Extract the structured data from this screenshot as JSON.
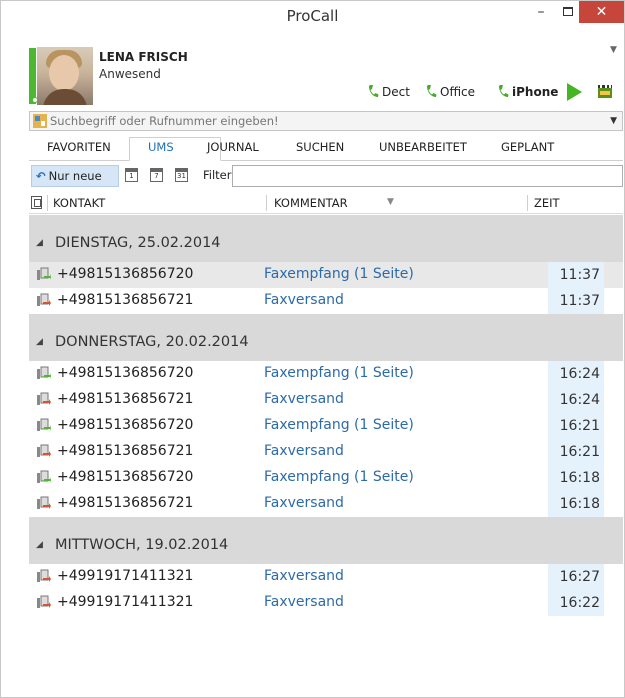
{
  "window": {
    "title": "ProCall",
    "minimize_glyph": "–",
    "close_glyph": "✕"
  },
  "user": {
    "name": "LENA FRISCH",
    "status": "Anwesend",
    "status_color": "#4cb82f"
  },
  "devices": [
    {
      "label": "Dect",
      "icon": "phone-icon"
    },
    {
      "label": "Office",
      "icon": "phone-icon"
    },
    {
      "label": "iPhone",
      "icon": "phone-icon"
    }
  ],
  "search": {
    "placeholder": "Suchbegriff oder Rufnummer eingeben!"
  },
  "tabs": [
    {
      "label": "FAVORITEN",
      "active": false
    },
    {
      "label": "UMS",
      "active": true
    },
    {
      "label": "JOURNAL",
      "active": false
    },
    {
      "label": "SUCHEN",
      "active": false
    },
    {
      "label": "UNBEARBEITET",
      "active": false
    },
    {
      "label": "GEPLANT",
      "active": false
    }
  ],
  "toolbar": {
    "nur_neue_label": "Nur neue",
    "cal_day": "1",
    "cal_week": "7",
    "cal_month": "31",
    "filter_label": "Filter",
    "filter_value": ""
  },
  "columns": {
    "kontakt": "KONTAKT",
    "kommentar": "KOMMENTAR",
    "zeit": "ZEIT"
  },
  "groups": [
    {
      "title": "DIENSTAG, 25.02.2014",
      "rows": [
        {
          "number": "+49815136856720",
          "comment": "Faxempfang (1 Seite)",
          "time": "11:37",
          "direction": "in",
          "selected": true
        },
        {
          "number": "+49815136856721",
          "comment": "Faxversand",
          "time": "11:37",
          "direction": "out",
          "selected": false
        }
      ]
    },
    {
      "title": "DONNERSTAG, 20.02.2014",
      "rows": [
        {
          "number": "+49815136856720",
          "comment": "Faxempfang (1 Seite)",
          "time": "16:24",
          "direction": "in",
          "selected": false
        },
        {
          "number": "+49815136856721",
          "comment": "Faxversand",
          "time": "16:24",
          "direction": "out",
          "selected": false
        },
        {
          "number": "+49815136856720",
          "comment": "Faxempfang (1 Seite)",
          "time": "16:21",
          "direction": "in",
          "selected": false
        },
        {
          "number": "+49815136856721",
          "comment": "Faxversand",
          "time": "16:21",
          "direction": "out",
          "selected": false
        },
        {
          "number": "+49815136856720",
          "comment": "Faxempfang (1 Seite)",
          "time": "16:18",
          "direction": "in",
          "selected": false
        },
        {
          "number": "+49815136856721",
          "comment": "Faxversand",
          "time": "16:18",
          "direction": "out",
          "selected": false
        }
      ]
    },
    {
      "title": "MITTWOCH, 19.02.2014",
      "rows": [
        {
          "number": "+49919171411321",
          "comment": "Faxversand",
          "time": "16:27",
          "direction": "out",
          "selected": false
        },
        {
          "number": "+49919171411321",
          "comment": "Faxversand",
          "time": "16:22",
          "direction": "out",
          "selected": false
        }
      ]
    }
  ],
  "colors": {
    "accent": "#1f6fb8",
    "link": "#2d6aa8",
    "group_bg": "#d9d9d9",
    "time_bg": "#e6f2fb",
    "close_bg": "#c7463c"
  }
}
